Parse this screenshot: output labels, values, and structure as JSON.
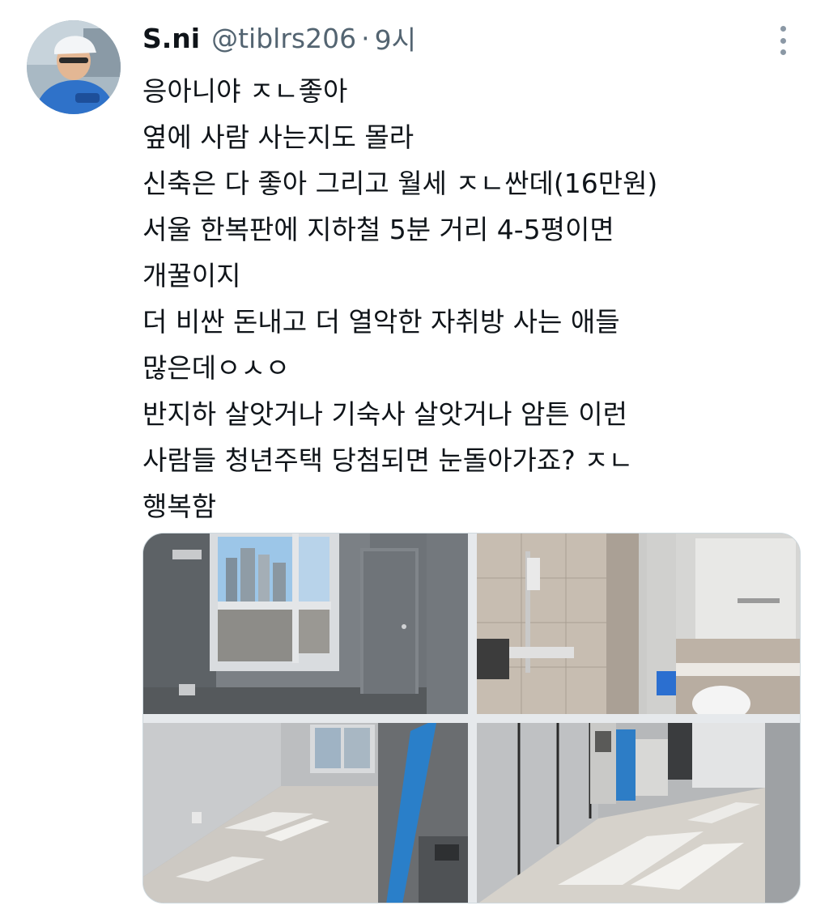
{
  "tweet": {
    "display_name": "S.ni",
    "handle": "@tiblrs206",
    "separator": "·",
    "time": "9시",
    "lines": [
      "응아니야 ㅈㄴ좋아",
      "옆에 사람 사는지도 몰라",
      "신축은 다 좋아 그리고 월세 ㅈㄴ싼데(16만원)",
      "서울 한복판에 지하철 5분 거리 4-5평이면",
      "개꿀이지",
      "더 비싼 돈내고 더 열악한 자취방 사는 애들",
      "많은데ㅇㅅㅇ",
      "반지하 살앗거나 기숙사 살앗거나 암튼 이런",
      "사람들 청년주택 당첨되면 눈돌아가죠? ㅈㄴ",
      "행복함"
    ]
  },
  "icons": {
    "avatar": "profile-avatar",
    "more": "more-options-icon"
  },
  "colors": {
    "text_primary": "#0f1419",
    "text_secondary": "#536471",
    "border": "#cfd9de"
  }
}
